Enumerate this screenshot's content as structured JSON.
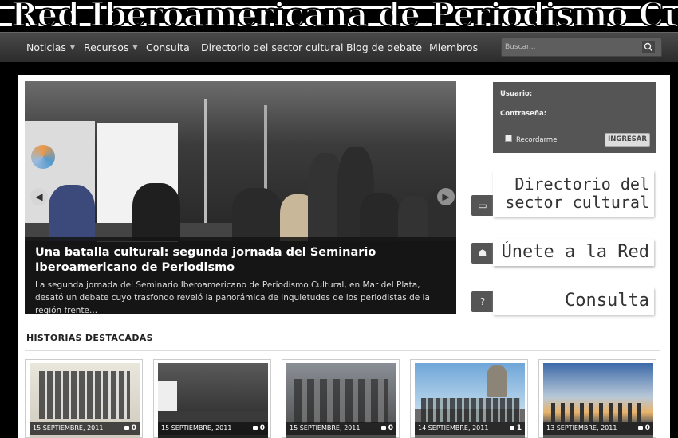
{
  "site": {
    "title": "Red Iberoamericana de Periodismo Cultural"
  },
  "nav": {
    "items": [
      {
        "label": "Noticias",
        "dropdown": true
      },
      {
        "label": "Recursos",
        "dropdown": true
      },
      {
        "label": "Consulta",
        "dropdown": false
      },
      {
        "label": "Directorio del sector cultural",
        "dropdown": false
      },
      {
        "label": "Blog de debate",
        "dropdown": false
      },
      {
        "label": "Miembros",
        "dropdown": false
      }
    ],
    "search_placeholder": "Buscar..."
  },
  "slider": {
    "headline": "Una batalla cultural: segunda jornada del Seminario Iberoamericano de Periodismo",
    "excerpt": "La segunda jornada del Seminario Iberoamericano de Periodismo Cultural, en Mar del Plata, desató un debate  cuyo trasfondo reveló la panorámica de inquietudes de los periodistas de la región frente..."
  },
  "login": {
    "user_label": "Usuario:",
    "password_label": "Contraseña:",
    "remember_label": "Recordarme",
    "submit_label": "INGRESAR"
  },
  "promos": [
    {
      "line1": "Directorio del",
      "line2": "sector cultural",
      "icon": "book-icon"
    },
    {
      "line1": "Únete a la Red",
      "line2": "",
      "icon": "users-icon"
    },
    {
      "line1": "Consulta",
      "line2": "",
      "icon": "question-icon"
    }
  ],
  "featured": {
    "title": "HISTORIAS DESTACADAS",
    "items": [
      {
        "date": "15 SEPTIEMBRE, 2011",
        "comments": "0"
      },
      {
        "date": "15 SEPTIEMBRE, 2011",
        "comments": "0"
      },
      {
        "date": "15 SEPTIEMBRE, 2011",
        "comments": "0"
      },
      {
        "date": "14 SEPTIEMBRE, 2011",
        "comments": "1"
      },
      {
        "date": "13 SEPTIEMBRE, 2011",
        "comments": "0"
      }
    ]
  },
  "colors": {
    "nav_bg": "#3a3a3a",
    "login_bg": "#555555",
    "caption_bg": "#141414"
  }
}
